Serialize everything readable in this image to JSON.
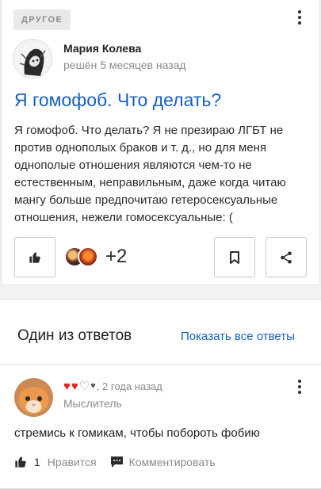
{
  "question": {
    "category": "ДРУГОЕ",
    "author": {
      "name": "Мария Колева",
      "meta": "решён 5 месяцев назад"
    },
    "title": "Я гомофоб. Что делать?",
    "body": "Я гомофоб. Что делать? Я не презираю ЛГБТ не против однополых браков и т. д., но для меня однополые отношения являются чем-то не естественным, неправильным, даже когда читаю мангу больше предпочитаю гетеросексуальные отношения, нежели гомосексуальные: (",
    "likers_count": "+2"
  },
  "answers": {
    "title": "Один из ответов",
    "show_all": "Показать все ответы",
    "item": {
      "hearts_full": 2,
      "hearts_empty": 1,
      "time": ", 2 года назад",
      "level": "Мыслитель",
      "text": "стремись к гомикам, чтобы побороть фобию",
      "likes": "1",
      "like_label": "Нравится",
      "comment_label": "Комментировать"
    }
  },
  "colors": {
    "link": "#1560c0",
    "heart": "#e02424"
  },
  "icons": [
    "kebab-menu-icon",
    "thumbs-up-icon",
    "bookmark-icon",
    "share-icon",
    "heart-icon",
    "comment-icon"
  ]
}
